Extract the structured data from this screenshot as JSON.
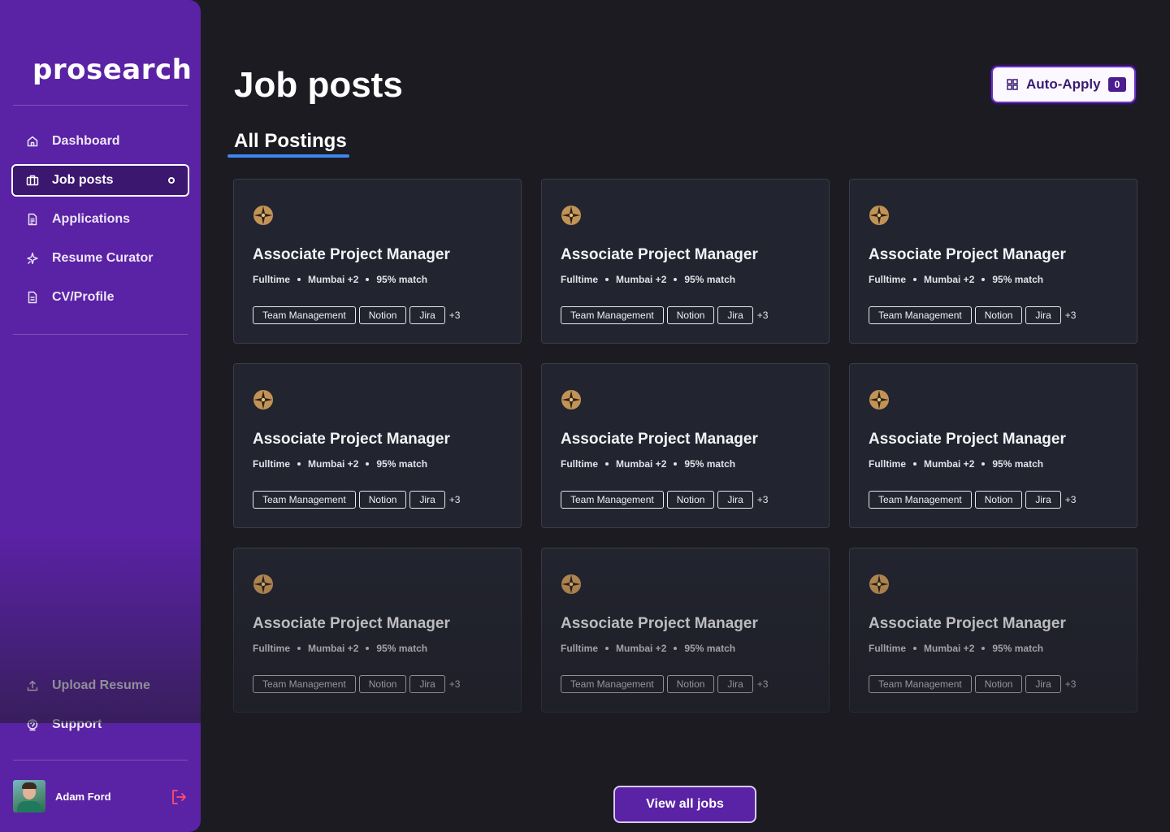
{
  "app": {
    "logo": "prosearch"
  },
  "sidebar": {
    "nav": [
      {
        "label": "Dashboard",
        "icon": "home-icon"
      },
      {
        "label": "Job posts",
        "icon": "briefcase-icon",
        "active": true
      },
      {
        "label": "Applications",
        "icon": "document-icon"
      },
      {
        "label": "Resume Curator",
        "icon": "sparkle-icon"
      },
      {
        "label": "CV/Profile",
        "icon": "file-icon"
      }
    ],
    "bottom_nav": [
      {
        "label": "Upload Resume",
        "icon": "upload-icon"
      },
      {
        "label": "Support",
        "icon": "support-icon"
      }
    ],
    "user": {
      "name": "Adam Ford"
    }
  },
  "header": {
    "title": "Job posts",
    "auto_apply": {
      "label": "Auto-Apply",
      "count": "0"
    }
  },
  "tabs": [
    {
      "label": "All Postings",
      "active": true
    }
  ],
  "jobs": [
    {
      "title": "Associate Project Manager",
      "type": "Fulltime",
      "location": "Mumbai +2",
      "match": "95% match",
      "tags": [
        "Team Management",
        "Notion",
        "Jira"
      ],
      "more": "+3"
    },
    {
      "title": "Associate Project Manager",
      "type": "Fulltime",
      "location": "Mumbai +2",
      "match": "95% match",
      "tags": [
        "Team Management",
        "Notion",
        "Jira"
      ],
      "more": "+3"
    },
    {
      "title": "Associate Project Manager",
      "type": "Fulltime",
      "location": "Mumbai +2",
      "match": "95% match",
      "tags": [
        "Team Management",
        "Notion",
        "Jira"
      ],
      "more": "+3"
    },
    {
      "title": "Associate Project Manager",
      "type": "Fulltime",
      "location": "Mumbai +2",
      "match": "95% match",
      "tags": [
        "Team Management",
        "Notion",
        "Jira"
      ],
      "more": "+3"
    },
    {
      "title": "Associate Project Manager",
      "type": "Fulltime",
      "location": "Mumbai +2",
      "match": "95% match",
      "tags": [
        "Team Management",
        "Notion",
        "Jira"
      ],
      "more": "+3"
    },
    {
      "title": "Associate Project Manager",
      "type": "Fulltime",
      "location": "Mumbai +2",
      "match": "95% match",
      "tags": [
        "Team Management",
        "Notion",
        "Jira"
      ],
      "more": "+3"
    },
    {
      "title": "Associate Project Manager",
      "type": "Fulltime",
      "location": "Mumbai +2",
      "match": "95% match",
      "tags": [
        "Team Management",
        "Notion",
        "Jira"
      ],
      "more": "+3"
    },
    {
      "title": "Associate Project Manager",
      "type": "Fulltime",
      "location": "Mumbai +2",
      "match": "95% match",
      "tags": [
        "Team Management",
        "Notion",
        "Jira"
      ],
      "more": "+3"
    },
    {
      "title": "Associate Project Manager",
      "type": "Fulltime",
      "location": "Mumbai +2",
      "match": "95% match",
      "tags": [
        "Team Management",
        "Notion",
        "Jira"
      ],
      "more": "+3"
    }
  ],
  "footer": {
    "view_all_label": "View all jobs"
  },
  "colors": {
    "sidebar_bg": "#5a22a4",
    "page_bg": "#1b1b21",
    "card_bg": "#22242f",
    "accent_underline": "#3f86ef",
    "logout_icon": "#ff4f6d",
    "company_icon": "#c29356"
  }
}
